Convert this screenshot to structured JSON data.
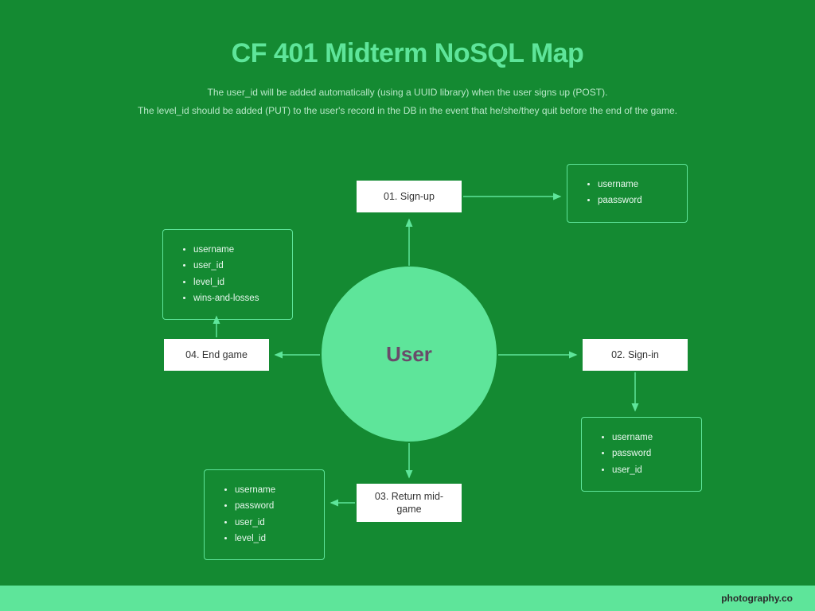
{
  "title": "CF 401 Midterm NoSQL Map",
  "subtitle_lines": [
    "The user_id will be added automatically (using a UUID library) when the user signs up (POST).",
    "The level_id should be added (PUT) to the user's record in the DB in the event that he/she/they quit before the end of the game."
  ],
  "center": "User",
  "steps": {
    "signup": "01. Sign-up",
    "signin": "02. Sign-in",
    "return_mid": "03. Return mid-game",
    "endgame": "04. End game"
  },
  "attrs": {
    "signup": [
      "username",
      "paassword"
    ],
    "signin": [
      "username",
      "password",
      "user_id"
    ],
    "return_mid": [
      "username",
      "password",
      "user_id",
      "level_id"
    ],
    "endgame": [
      "username",
      "user_id",
      "level_id",
      "wins-and-losses"
    ]
  },
  "footer": "photography.co"
}
